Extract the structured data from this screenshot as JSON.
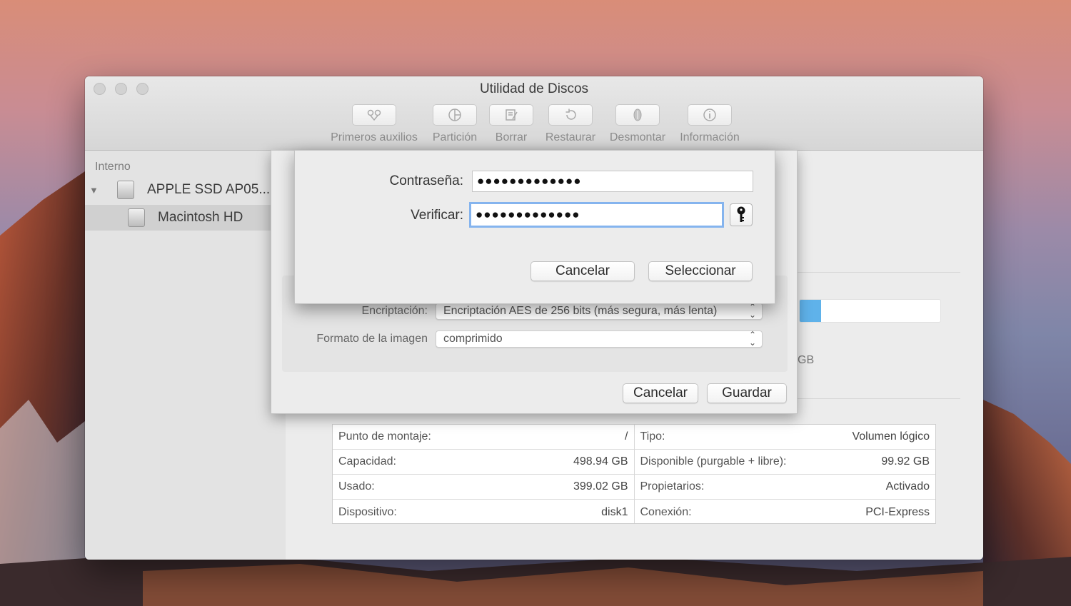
{
  "window": {
    "title": "Utilidad de Discos"
  },
  "toolbar": {
    "items": [
      {
        "label": "Primeros auxilios",
        "icon": "stethoscope-icon"
      },
      {
        "label": "Partición",
        "icon": "partition-icon"
      },
      {
        "label": "Borrar",
        "icon": "erase-icon"
      },
      {
        "label": "Restaurar",
        "icon": "restore-icon"
      },
      {
        "label": "Desmontar",
        "icon": "unmount-icon"
      },
      {
        "label": "Información",
        "icon": "info-icon"
      }
    ]
  },
  "sidebar": {
    "section": "Interno",
    "disk": "APPLE SSD AP05...",
    "volume": "Macintosh HD"
  },
  "main": {
    "usage_fill_fraction": 0.15,
    "partial_label": "GB",
    "info": {
      "left": [
        {
          "k": "Punto de montaje:",
          "v": "/"
        },
        {
          "k": "Capacidad:",
          "v": "498.94 GB"
        },
        {
          "k": "Usado:",
          "v": "399.02 GB"
        },
        {
          "k": "Dispositivo:",
          "v": "disk1"
        }
      ],
      "right": [
        {
          "k": "Tipo:",
          "v": "Volumen lógico"
        },
        {
          "k": "Disponible (purgable + libre):",
          "v": "99.92 GB"
        },
        {
          "k": "Propietarios:",
          "v": "Activado"
        },
        {
          "k": "Conexión:",
          "v": "PCI-Express"
        }
      ]
    }
  },
  "save_sheet": {
    "encryption_label": "Encriptación:",
    "encryption_value": "Encriptación AES de 256 bits (más segura, más lenta)",
    "format_label": "Formato de la imagen",
    "format_value": "comprimido",
    "cancel": "Cancelar",
    "save": "Guardar"
  },
  "password_dialog": {
    "password_label": "Contraseña:",
    "password_value": "●●●●●●●●●●●●●",
    "verify_label": "Verificar:",
    "verify_value": "●●●●●●●●●●●●●",
    "cancel": "Cancelar",
    "select": "Seleccionar"
  },
  "colors": {
    "accent_blue": "#5fb2ea",
    "focus_ring": "#85b4ee"
  }
}
